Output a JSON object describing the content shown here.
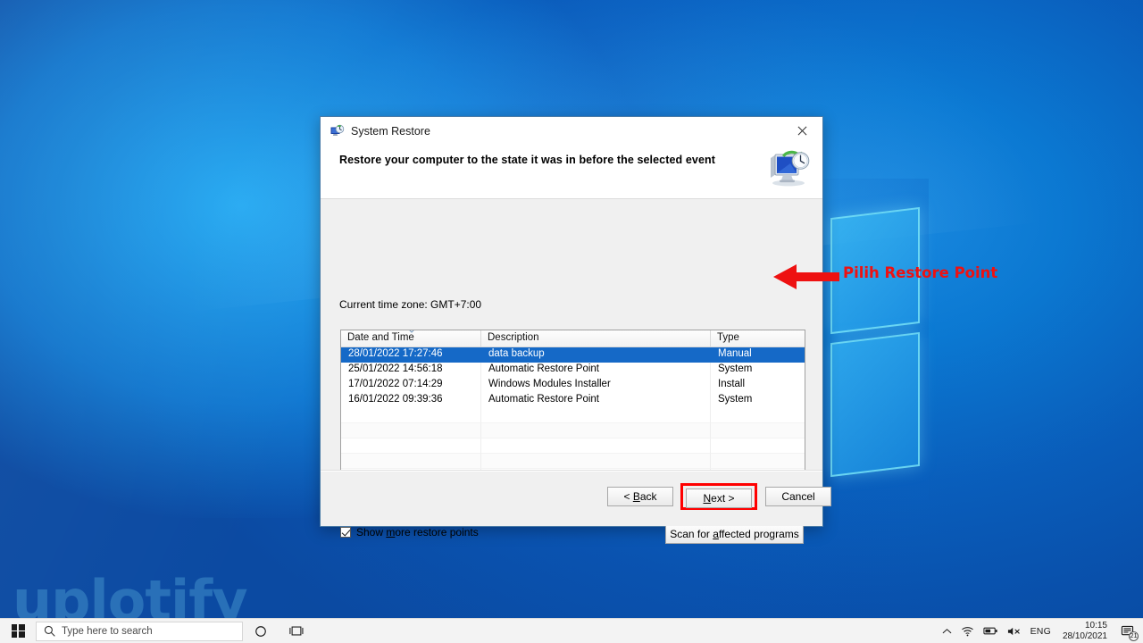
{
  "desktop": {
    "watermark": "uplotify"
  },
  "annotation": {
    "text": "Pilih Restore Point",
    "color": "#ee1111",
    "icon": "left-arrow-icon"
  },
  "dialog": {
    "title": "System Restore",
    "title_icon": "system-restore-icon",
    "close_icon": "close-icon",
    "instruction": "Restore your computer to the state it was in before the selected event",
    "header_art_icon": "restore-computer-illustration",
    "timezone_label": "Current time zone: GMT+7:00",
    "columns": [
      "Date and Time",
      "Description",
      "Type"
    ],
    "sort_indicator": "chevron-up-icon",
    "rows": [
      {
        "date": "28/01/2022 17:27:46",
        "description": "data backup",
        "type": "Manual",
        "selected": true
      },
      {
        "date": "25/01/2022 14:56:18",
        "description": "Automatic Restore Point",
        "type": "System",
        "selected": false
      },
      {
        "date": "17/01/2022 07:14:29",
        "description": "Windows Modules Installer",
        "type": "Install",
        "selected": false
      },
      {
        "date": "16/01/2022 09:39:36",
        "description": "Automatic Restore Point",
        "type": "System",
        "selected": false
      }
    ],
    "empty_row_count": 7,
    "checkbox": {
      "label_before": "Show ",
      "label_accel": "m",
      "label_after": "ore restore points",
      "checked": true
    },
    "scan_button": {
      "label_before": "Scan for ",
      "label_accel": "a",
      "label_after": "ffected programs"
    },
    "back_button": {
      "label_before": "< ",
      "label_accel": "B",
      "label_after": "ack"
    },
    "next_button": {
      "label_before": "",
      "label_accel": "N",
      "label_after": "ext >",
      "highlighted": true,
      "highlight_color": "#ff0000"
    },
    "cancel_button": {
      "label": "Cancel"
    }
  },
  "taskbar": {
    "start_icon": "windows-start-icon",
    "search_icon": "search-icon",
    "search_placeholder": "Type here to search",
    "cortana_icon": "cortana-circle-icon",
    "taskview_icon": "task-view-icon",
    "tray": {
      "overflow_icon": "chevron-up-icon",
      "network_icon": "wifi-icon",
      "battery_icon": "battery-icon",
      "volume_icon": "volume-muted-icon",
      "language": "ENG",
      "time": "10:15",
      "date": "28/10/2021",
      "notification_icon": "notification-icon",
      "notification_count": "21"
    }
  }
}
